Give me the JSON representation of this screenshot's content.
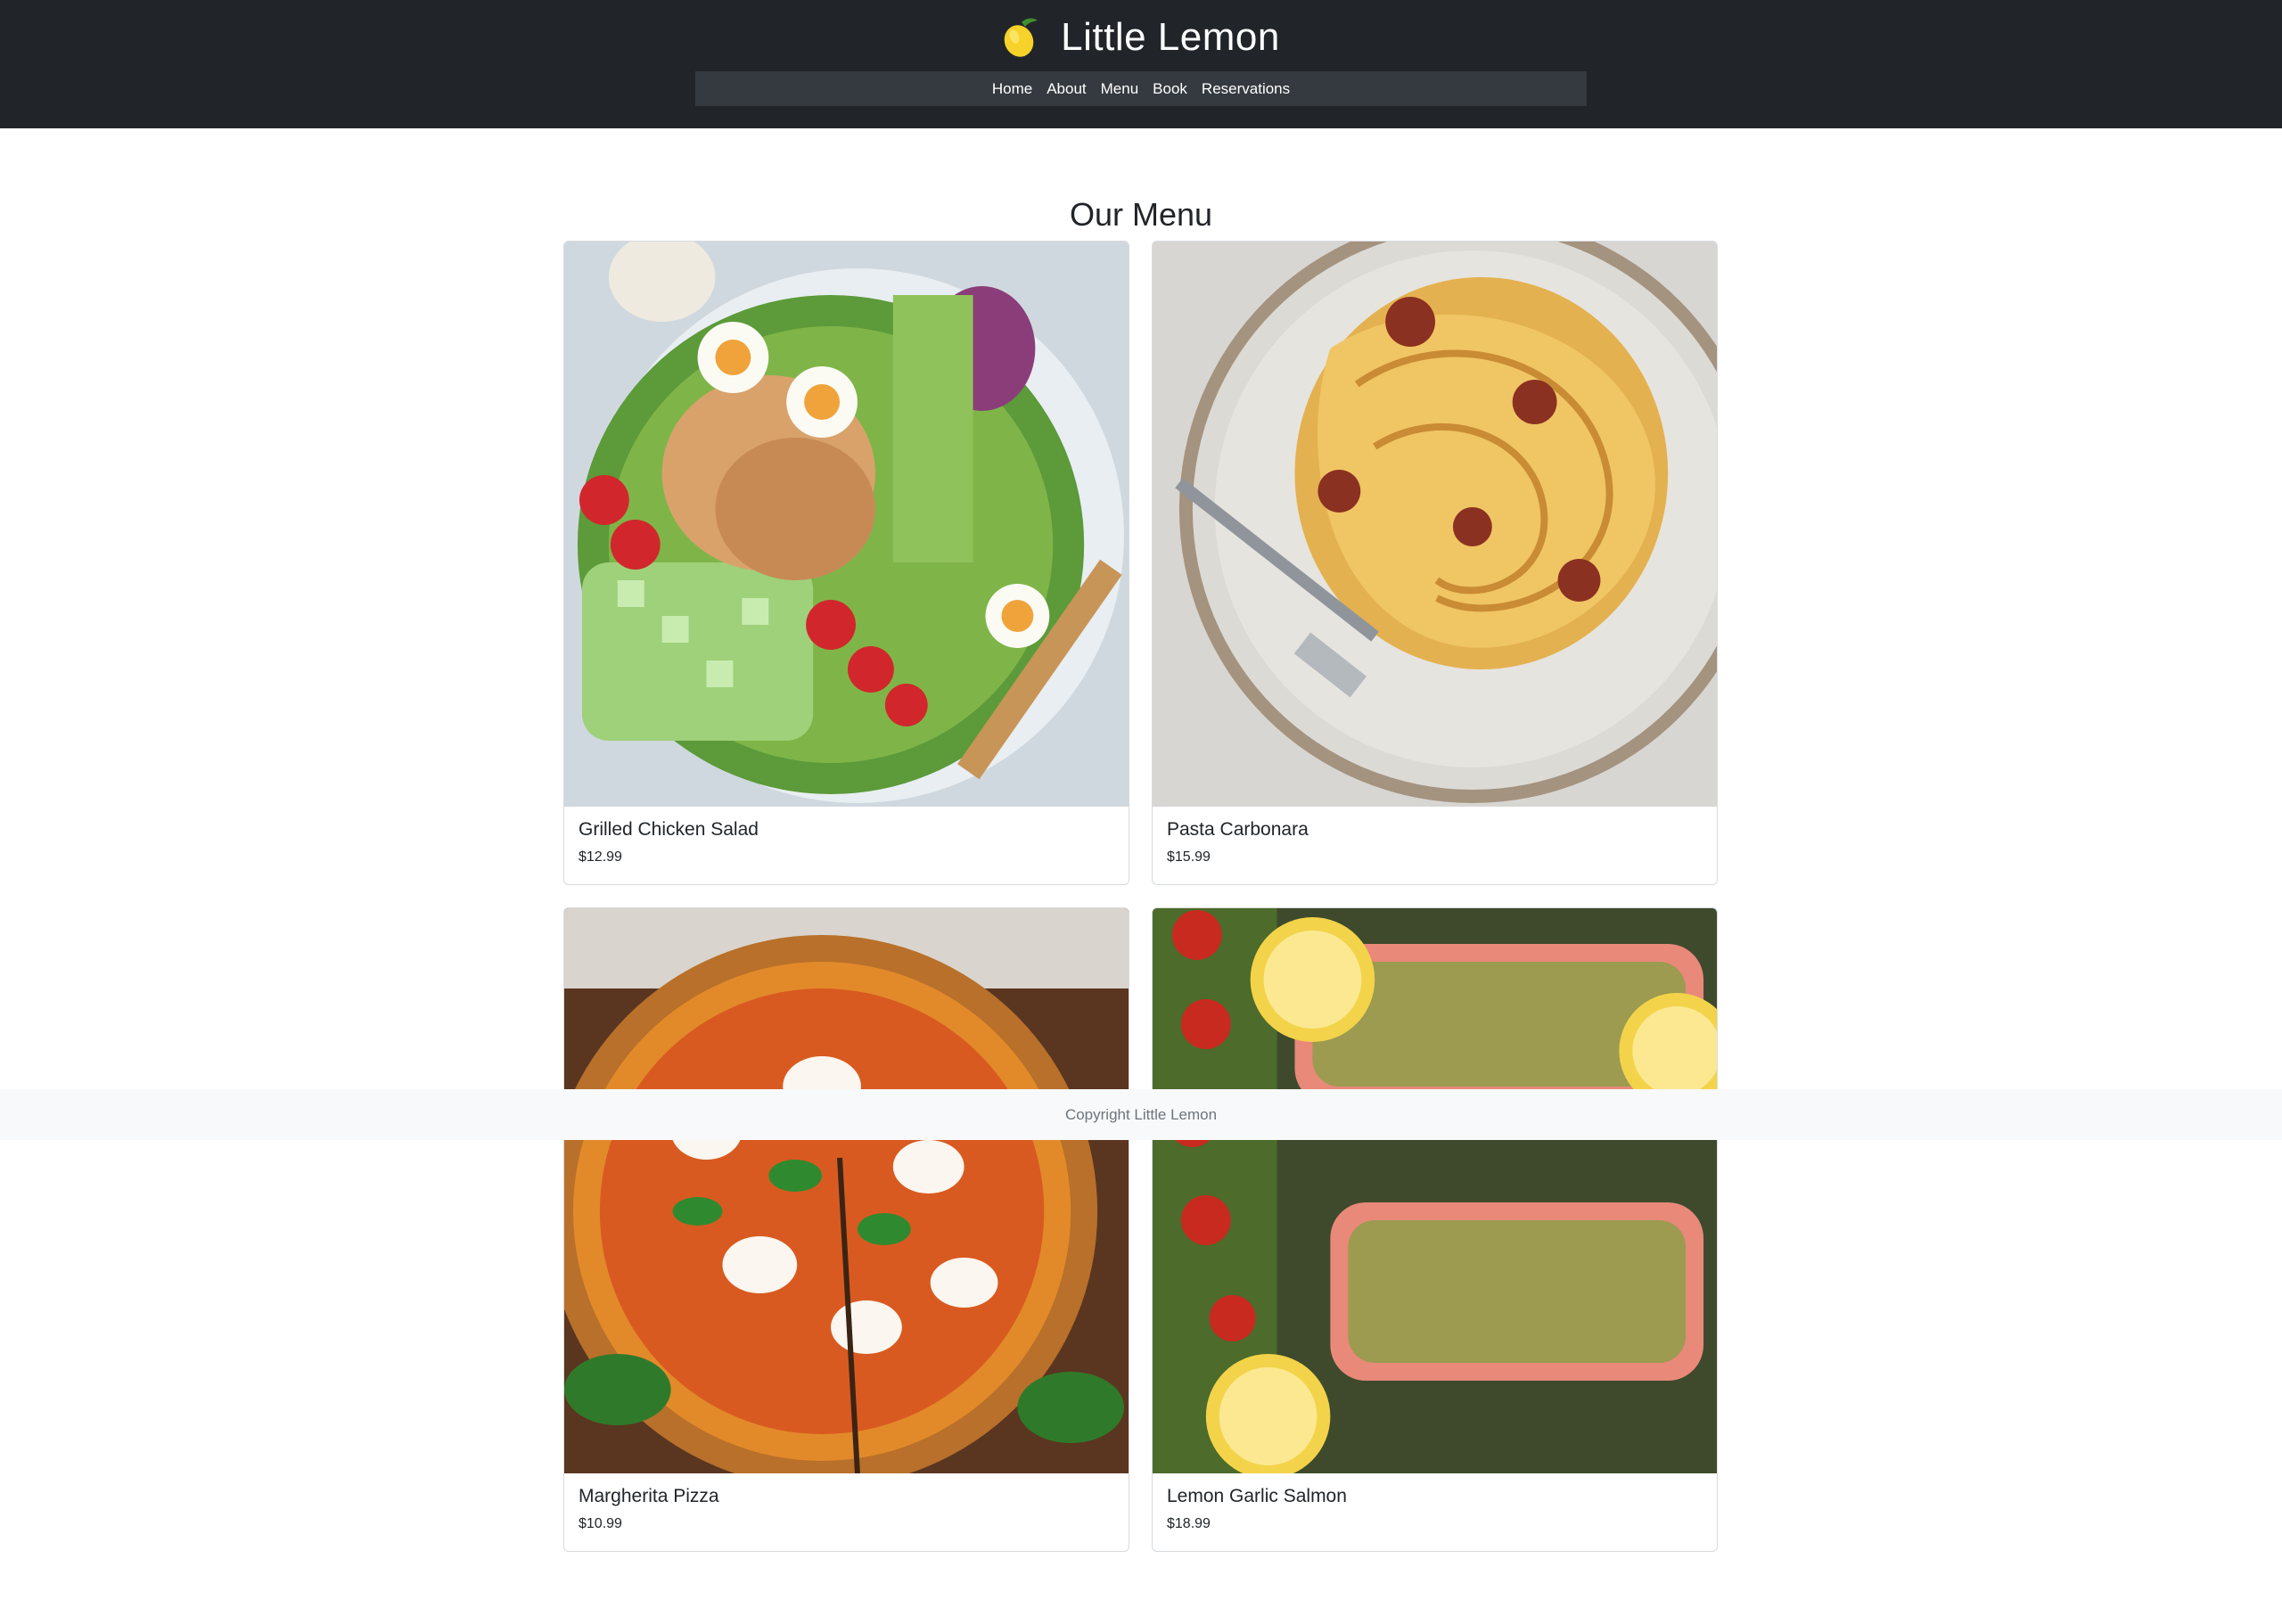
{
  "header": {
    "logo_icon": "lemon-icon",
    "title": "Little Lemon",
    "bg_color": "#212529",
    "nav_bg_color": "#343a40"
  },
  "nav": {
    "items": [
      "Home",
      "About",
      "Menu",
      "Book",
      "Reservations"
    ]
  },
  "main": {
    "heading": "Our Menu",
    "items": [
      {
        "name": "Grilled Chicken Salad",
        "price": "$12.99"
      },
      {
        "name": "Pasta Carbonara",
        "price": "$15.99"
      },
      {
        "name": "Margherita Pizza",
        "price": "$10.99"
      },
      {
        "name": "Lemon Garlic Salmon",
        "price": "$18.99"
      }
    ]
  },
  "footer": {
    "text": "Copyright Little Lemon"
  }
}
